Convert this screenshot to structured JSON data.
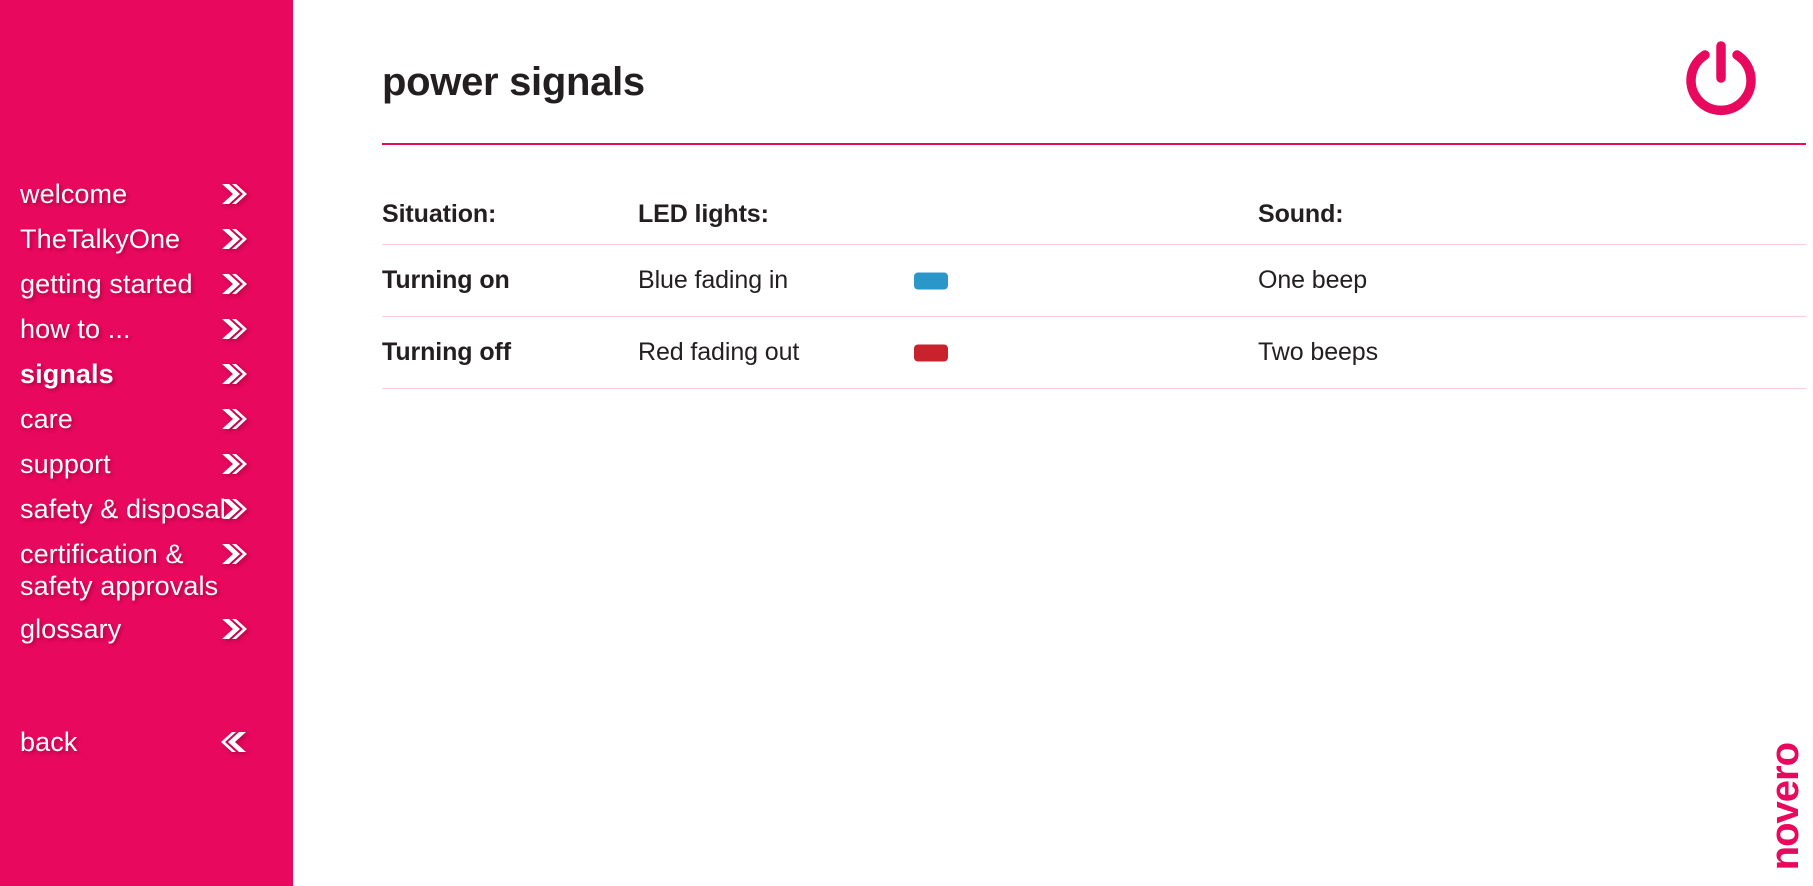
{
  "sidebar": {
    "background_color": "#e8085e",
    "items": [
      {
        "label": "welcome",
        "icon": "chevron-right-icon",
        "active": false
      },
      {
        "label": "TheTalkyOne",
        "icon": "chevron-right-icon",
        "active": false
      },
      {
        "label": "getting started",
        "icon": "chevron-right-icon",
        "active": false
      },
      {
        "label": "how to ...",
        "icon": "chevron-right-icon",
        "active": false
      },
      {
        "label": "signals",
        "icon": "chevron-right-icon",
        "active": true
      },
      {
        "label": "care",
        "icon": "chevron-right-icon",
        "active": false
      },
      {
        "label": "support",
        "icon": "chevron-right-icon",
        "active": false
      },
      {
        "label": "safety & disposal",
        "icon": "chevron-right-icon",
        "active": false
      },
      {
        "label": "certification &\nsafety approvals",
        "icon": "chevron-right-icon",
        "active": false,
        "two_line": true
      },
      {
        "label": "glossary",
        "icon": "chevron-right-icon",
        "active": false
      }
    ],
    "back": {
      "label": "back",
      "icon": "chevron-left-icon"
    }
  },
  "header": {
    "title": "power signals",
    "icon": "power-icon",
    "accent_color": "#e8085e"
  },
  "table": {
    "columns": [
      "Situation:",
      "LED lights:",
      "Sound:"
    ],
    "rows": [
      {
        "situation": "Turning on",
        "led_lights": "Blue fading in",
        "led_color": "#2b97c9",
        "sound": "One beep"
      },
      {
        "situation": "Turning off",
        "led_lights": "Red fading out",
        "led_color": "#c8232c",
        "sound": "Two beeps"
      }
    ],
    "rule_color": "#f6cdd8"
  },
  "footer": {
    "brand": "novero"
  }
}
